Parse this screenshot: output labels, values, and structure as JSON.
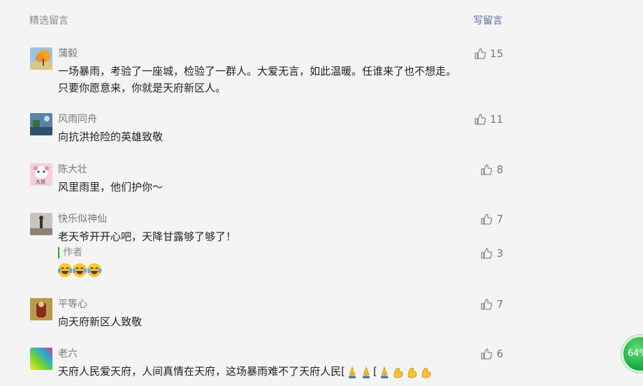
{
  "header": {
    "title": "精选留言",
    "write": "写留言"
  },
  "comments": [
    {
      "nick": "蒲毅",
      "likes": "15",
      "lines": [
        "一场暴雨，考验了一座城，检验了一群人。大爱无言，如此温暖。任谁来了也不想走。",
        "只要你愿意来，你就是天府新区人。"
      ]
    },
    {
      "nick": "风雨同舟",
      "likes": "11",
      "lines": [
        "向抗洪抢险的英雄致敬"
      ]
    },
    {
      "nick": "陈大壮",
      "likes": "8",
      "lines": [
        "风里雨里，他们护你～"
      ],
      "avatar_text": "大哥"
    },
    {
      "nick": "快乐似神仙",
      "likes": "7",
      "lines": [
        "老天爷开开心吧，天降甘露够了够了！"
      ],
      "reply": {
        "author": "作者",
        "likes": "3"
      }
    },
    {
      "nick": "平等心",
      "likes": "7",
      "lines": [
        "向天府新区人致敬"
      ]
    },
    {
      "nick": "老六",
      "likes": "6",
      "lines": [
        "天府人民爱天府，人间真情在天府，这场暴雨难不了天府人民["
      ],
      "line_tail": "["
    }
  ],
  "badge": {
    "text": "64%"
  },
  "colors": {
    "link": "#576b95",
    "reply_bar": "#1aad19",
    "badge": "#16a53a"
  },
  "icons": {
    "like": "thumbs-up-icon",
    "reply_emoji": "laugh-tears-emoji",
    "tail_emoji": [
      "pray-emoji",
      "muscle-emoji"
    ]
  }
}
